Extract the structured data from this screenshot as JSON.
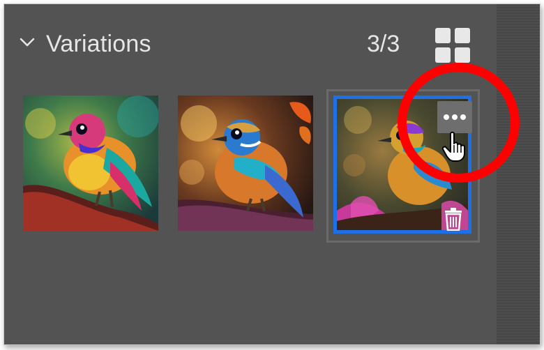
{
  "panel": {
    "title": "Variations",
    "count": "3/3",
    "expand_icon": "chevron-down-icon",
    "view_toggle_icon": "grid-view-icon"
  },
  "variations": [
    {
      "name": "variation-1",
      "selected": false
    },
    {
      "name": "variation-2",
      "selected": false
    },
    {
      "name": "variation-3",
      "selected": true
    }
  ],
  "actions": {
    "more_icon": "more-options-icon",
    "delete_icon": "trash-icon"
  },
  "annotation": {
    "type": "highlight-circle",
    "color": "#ff0000"
  },
  "colors": {
    "panel_bg": "#535353",
    "selection": "#1f6fe5",
    "text": "#e6e6e6"
  }
}
